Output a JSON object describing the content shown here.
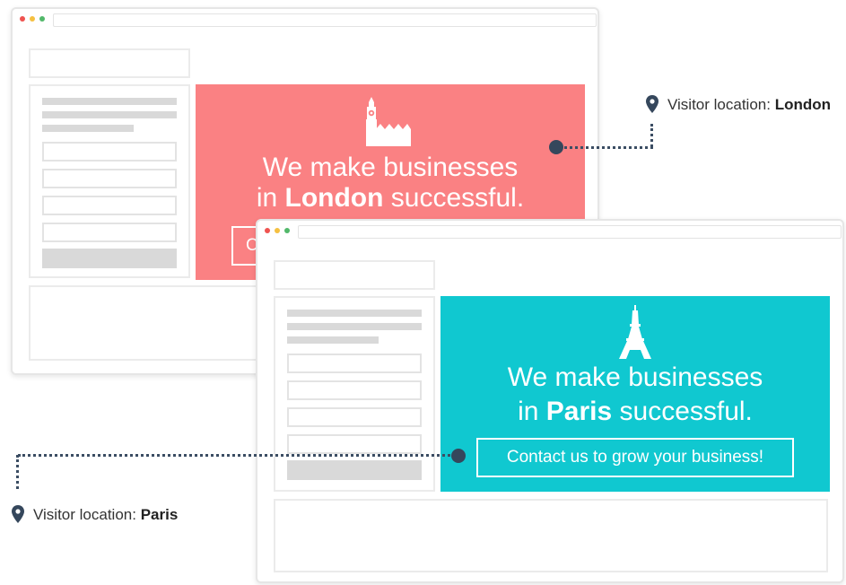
{
  "colors": {
    "london_hero": "#fa8183",
    "paris_hero": "#10c8d0",
    "connector": "#3b4d63",
    "dot_red": "#ef5350",
    "dot_yellow": "#f5c041",
    "dot_green": "#52b86a"
  },
  "london": {
    "headline_line1": "We make businesses",
    "headline_prefix": "in ",
    "city": "London",
    "headline_suffix": " successful.",
    "cta_partial": "C",
    "caption_label": "Visitor location: ",
    "caption_city": "London",
    "landmark_icon": "big-ben-icon"
  },
  "paris": {
    "headline_line1": "We make businesses",
    "headline_prefix": "in ",
    "city": "Paris",
    "headline_suffix": " successful.",
    "cta": "Contact us to grow your business!",
    "caption_label": "Visitor location: ",
    "caption_city": "Paris",
    "landmark_icon": "eiffel-tower-icon"
  },
  "icons": {
    "location": "map-pin-icon"
  }
}
